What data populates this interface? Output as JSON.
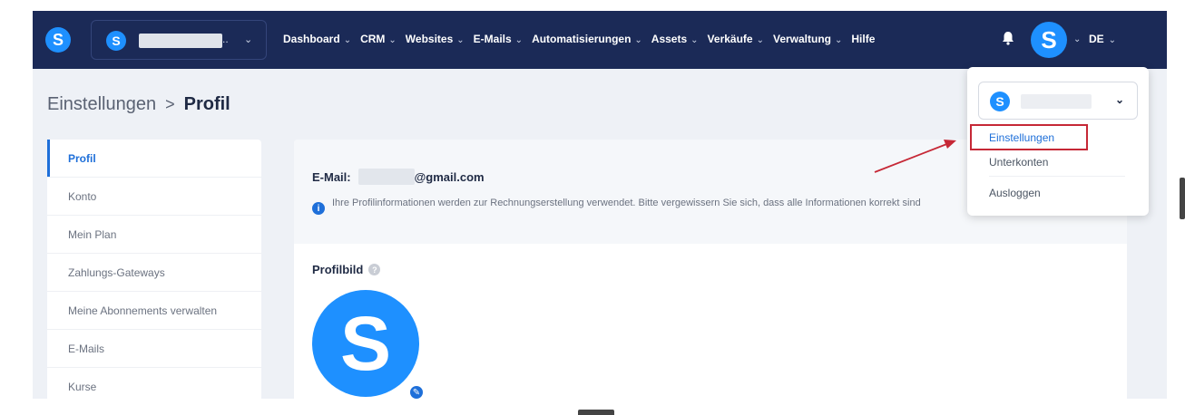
{
  "topbar": {
    "logo_letter": "S",
    "account_logo_letter": "S",
    "account_dots": "..",
    "nav": [
      {
        "label": "Dashboard",
        "has_caret": true
      },
      {
        "label": "CRM",
        "has_caret": true
      },
      {
        "label": "Websites",
        "has_caret": true
      },
      {
        "label": "E-Mails",
        "has_caret": true
      },
      {
        "label": "Automatisierungen",
        "has_caret": true
      },
      {
        "label": "Assets",
        "has_caret": true
      },
      {
        "label": "Verkäufe",
        "has_caret": true
      },
      {
        "label": "Verwaltung",
        "has_caret": true
      },
      {
        "label": "Hilfe",
        "has_caret": false
      }
    ],
    "bell_icon": "bell-icon",
    "avatar_letter": "S",
    "language": "DE",
    "caret": "⌄"
  },
  "breadcrumb": {
    "parent": "Einstellungen",
    "separator": ">",
    "current": "Profil"
  },
  "sidebar": {
    "items": [
      {
        "label": "Profil",
        "active": true
      },
      {
        "label": "Konto",
        "active": false
      },
      {
        "label": "Mein Plan",
        "active": false
      },
      {
        "label": "Zahlungs-Gateways",
        "active": false
      },
      {
        "label": "Meine Abonnements verwalten",
        "active": false
      },
      {
        "label": "E-Mails",
        "active": false
      },
      {
        "label": "Kurse",
        "active": false
      }
    ]
  },
  "main": {
    "email_label": "E-Mail:",
    "email_suffix": "@gmail.com",
    "info_icon": "i",
    "info_text": "Ihre Profilinformationen werden zur Rechnungserstellung verwendet. Bitte vergewissern Sie sich, dass alle Informationen korrekt sind",
    "profilbild_label": "Profilbild",
    "help_icon": "?",
    "avatar_letter": "S",
    "edit_icon": "✎"
  },
  "dropdown": {
    "logo_letter": "S",
    "chevron": "⌄",
    "items": [
      "Einstellungen",
      "Unterkonten",
      "Ausloggen"
    ]
  },
  "colors": {
    "navbar": "#1b2a57",
    "brand_blue": "#1e90ff",
    "active_blue": "#1e6fd9",
    "highlight_red": "#c62836",
    "page_bg": "#eef1f6"
  }
}
